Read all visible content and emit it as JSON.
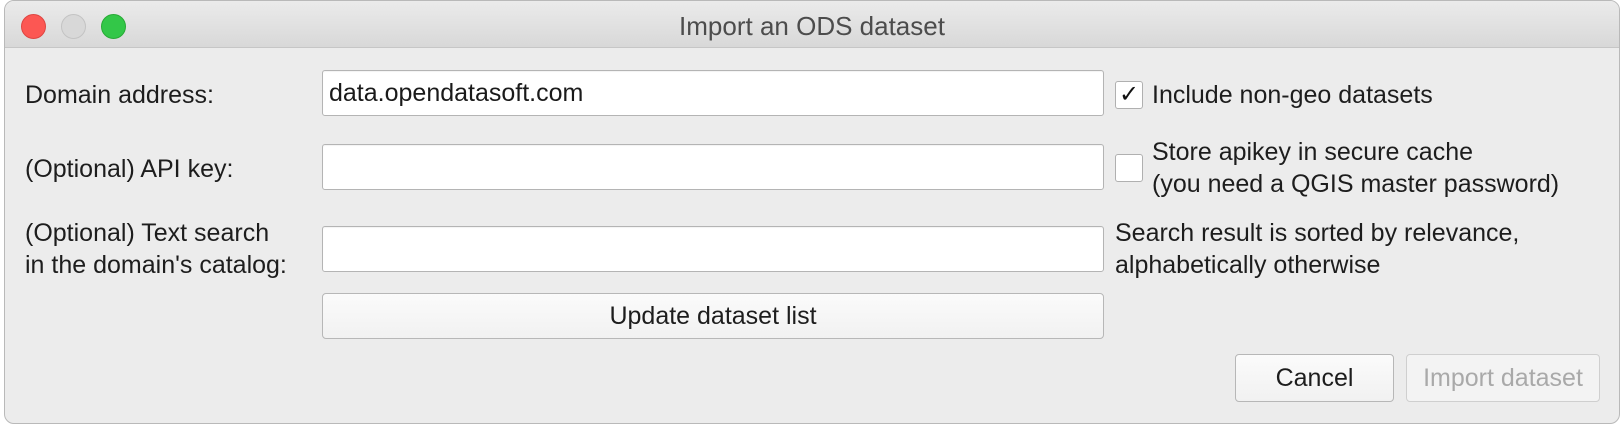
{
  "window": {
    "title": "Import an ODS dataset"
  },
  "form": {
    "domain_label": "Domain address:",
    "domain_value": "data.opendatasoft.com",
    "api_key_label": "(Optional) API key:",
    "api_key_value": "",
    "search_label": "(Optional) Text search\nin the domain's catalog:",
    "search_value": ""
  },
  "options": {
    "include_non_geo": {
      "label": "Include non-geo datasets",
      "checked": true,
      "checkmark": "✓"
    },
    "store_apikey": {
      "label": "Store apikey in secure cache\n(you need a QGIS master password)",
      "checked": false
    },
    "search_hint": "Search result is sorted by relevance,\nalphabetically otherwise"
  },
  "buttons": {
    "update": "Update dataset list",
    "cancel": "Cancel",
    "import": "Import dataset",
    "import_enabled": false
  },
  "colors": {
    "close": "#fc5753",
    "minimize_inactive": "#d8d8d8",
    "maximize": "#33c748"
  }
}
